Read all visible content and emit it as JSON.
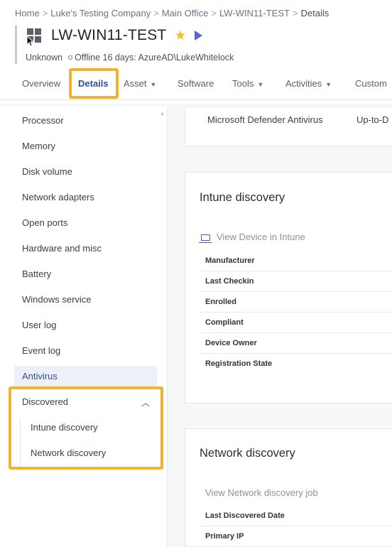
{
  "breadcrumb": {
    "items": [
      "Home",
      "Luke's Testing Company",
      "Main Office",
      "LW-WIN11-TEST"
    ],
    "current": "Details",
    "separator": ">"
  },
  "device": {
    "name": "LW-WIN11-TEST",
    "status_prefix": "Unknown",
    "status_detail": "Offline 16 days: AzureAD\\LukeWhitelock",
    "icon": "windows-logo-icon",
    "favorite_icon": "star-icon",
    "action_icon": "play-icon"
  },
  "tabs": [
    {
      "label": "Overview",
      "active": false
    },
    {
      "label": "Details",
      "active": true
    },
    {
      "label": "Asset",
      "dropdown": true
    },
    {
      "label": "Software"
    },
    {
      "label": "Tools",
      "dropdown": true
    },
    {
      "label": "Activities",
      "dropdown": true
    },
    {
      "label": "Custom"
    }
  ],
  "sidebar": {
    "items": [
      "Processor",
      "Memory",
      "Disk volume",
      "Network adapters",
      "Open ports",
      "Hardware and misc",
      "Battery",
      "Windows service",
      "User log",
      "Event log",
      "Antivirus"
    ],
    "active": "Antivirus",
    "group": {
      "label": "Discovered",
      "expanded": true,
      "children": [
        "Intune discovery",
        "Network discovery"
      ]
    }
  },
  "antivirus": {
    "product": "Microsoft Defender Antivirus",
    "status": "Up-to-D"
  },
  "intune": {
    "title": "Intune discovery",
    "link": "View Device in Intune",
    "fields": [
      "Manufacturer",
      "Last Checkin",
      "Enrolled",
      "Compliant",
      "Device Owner",
      "Registration State"
    ]
  },
  "network_discovery": {
    "title": "Network discovery",
    "link": "View Network discovery job",
    "fields": [
      "Last Discovered Date",
      "Primary IP"
    ]
  },
  "colors": {
    "accent": "#2d4fa0",
    "highlight": "#f1b232",
    "star": "#f2c12e",
    "play": "#5a63c9"
  }
}
